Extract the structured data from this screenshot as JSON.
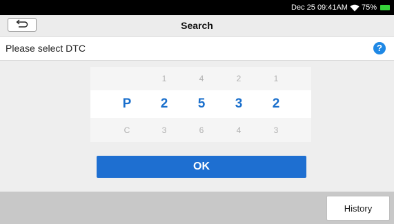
{
  "status_bar": {
    "time": "Dec 25 09:41AM",
    "battery": "75%",
    "icons": [
      "wifi-icon",
      "battery-icon"
    ]
  },
  "header": {
    "title": "Search",
    "back_icon": "back-arrow-icon"
  },
  "prompt": {
    "text": "Please select DTC",
    "help_label": "?",
    "help_icon": "help-icon"
  },
  "picker": {
    "columns": [
      {
        "above": "",
        "selected": "P",
        "below": "C"
      },
      {
        "above": "1",
        "selected": "2",
        "below": "3"
      },
      {
        "above": "4",
        "selected": "5",
        "below": "6"
      },
      {
        "above": "2",
        "selected": "3",
        "below": "4"
      },
      {
        "above": "1",
        "selected": "2",
        "below": "3"
      }
    ]
  },
  "actions": {
    "ok_label": "OK",
    "history_label": "History"
  },
  "colors": {
    "accent": "#1e6fd1",
    "selected_digit": "#1a6fcc",
    "help": "#1e88e5",
    "battery": "#36d43a"
  }
}
